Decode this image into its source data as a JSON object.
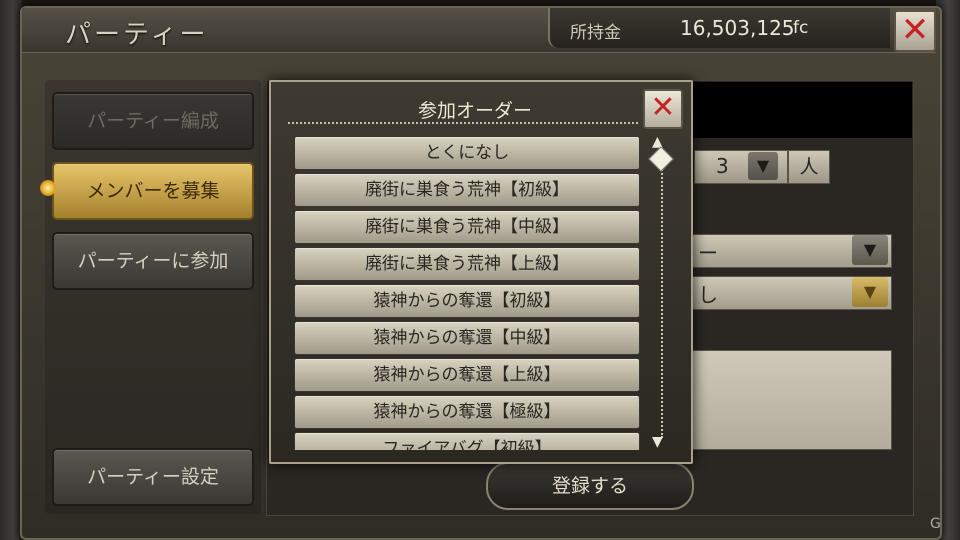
{
  "header": {
    "title": "パーティー",
    "money_label": "所持金",
    "money_value": "16,503,125",
    "money_unit": "fc",
    "close_glyph": "✕"
  },
  "sidebar": {
    "items": [
      {
        "label": "パーティー編成",
        "state": "disabled"
      },
      {
        "label": "メンバーを募集",
        "state": "active"
      },
      {
        "label": "パーティーに参加",
        "state": "normal"
      },
      {
        "label": "パーティー設定",
        "state": "normal"
      }
    ]
  },
  "form": {
    "member_count": "3",
    "member_unit": "人",
    "select1_value": "ー",
    "select2_value": "し",
    "select_arrow_glyph": "▼"
  },
  "register_button": "登録する",
  "modal": {
    "title": "参加オーダー",
    "close_glyph": "✕",
    "options": [
      "とくになし",
      "廃街に巣食う荒神【初級】",
      "廃街に巣食う荒神【中級】",
      "廃街に巣食う荒神【上級】",
      "猿神からの奪還【初級】",
      "猿神からの奪還【中級】",
      "猿神からの奪還【上級】",
      "猿神からの奪還【極級】",
      "ファイアバグ【初級】"
    ],
    "scroll_up_glyph": "▲",
    "scroll_down_glyph": "▼"
  },
  "watermark": "G",
  "colors": {
    "accent_gold": "#d8b45a",
    "close_red": "#c62424"
  }
}
